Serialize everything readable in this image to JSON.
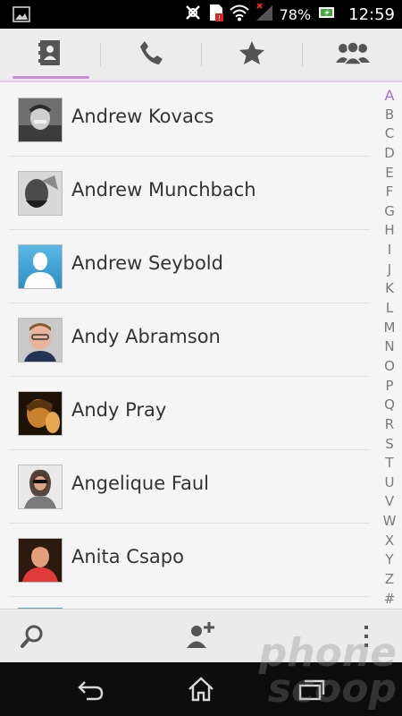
{
  "status_bar": {
    "battery_percent": "78%",
    "time": "12:59"
  },
  "tabs": [
    {
      "name": "contacts",
      "icon": "contacts-book-icon",
      "active": true
    },
    {
      "name": "phone",
      "icon": "phone-icon",
      "active": false
    },
    {
      "name": "favorites",
      "icon": "star-icon",
      "active": false
    },
    {
      "name": "groups",
      "icon": "groups-icon",
      "active": false
    }
  ],
  "contacts": [
    {
      "name": "Andrew Kovacs",
      "avatar": "photo"
    },
    {
      "name": "Andrew Munchbach",
      "avatar": "photo"
    },
    {
      "name": "Andrew Seybold",
      "avatar": "default-silhouette"
    },
    {
      "name": "Andy Abramson",
      "avatar": "photo"
    },
    {
      "name": "Andy Pray",
      "avatar": "photo"
    },
    {
      "name": "Angelique Faul",
      "avatar": "photo"
    },
    {
      "name": "Anita Csapo",
      "avatar": "photo"
    }
  ],
  "index_letters": [
    "A",
    "B",
    "C",
    "D",
    "E",
    "F",
    "G",
    "H",
    "I",
    "J",
    "K",
    "L",
    "M",
    "N",
    "O",
    "P",
    "Q",
    "R",
    "S",
    "T",
    "U",
    "V",
    "W",
    "X",
    "Y",
    "Z",
    "#"
  ],
  "index_active": "A",
  "action_bar": {
    "search_icon": "search-icon",
    "add_contact_icon": "add-contact-icon",
    "overflow_icon": "overflow-menu-icon"
  },
  "nav_bar": {
    "back_icon": "back-icon",
    "home_icon": "home-icon",
    "recents_icon": "recent-apps-icon"
  },
  "watermark": {
    "line1": "phone",
    "line2": "scoop"
  },
  "colors": {
    "accent": "#b06ac4",
    "background": "#f5f5f5",
    "statusbar": "#000000"
  }
}
